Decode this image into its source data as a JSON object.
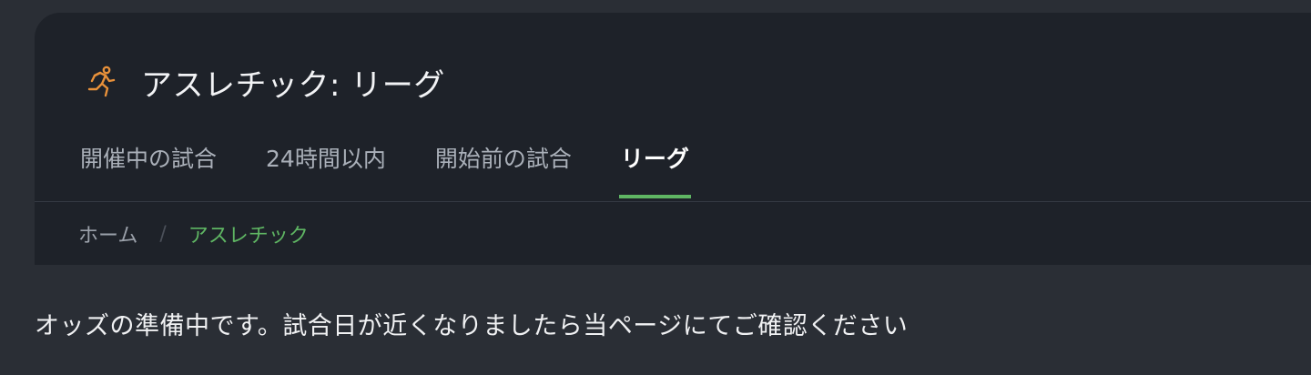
{
  "header": {
    "icon": "running-person-icon",
    "icon_color": "#e8913a",
    "title": "アスレチック: リーグ"
  },
  "tabs": [
    {
      "label": "開催中の試合",
      "active": false
    },
    {
      "label": "24時間以内",
      "active": false
    },
    {
      "label": "開始前の試合",
      "active": false
    },
    {
      "label": "リーグ",
      "active": true
    }
  ],
  "breadcrumb": {
    "home": "ホーム",
    "separator": "/",
    "current": "アスレチック"
  },
  "notice": "オッズの準備中です。試合日が近くなりましたら当ページにてご確認ください",
  "colors": {
    "page_bg": "#2a2e35",
    "card_bg": "#1e2229",
    "accent_green": "#5fb663",
    "icon_orange": "#e8913a"
  }
}
